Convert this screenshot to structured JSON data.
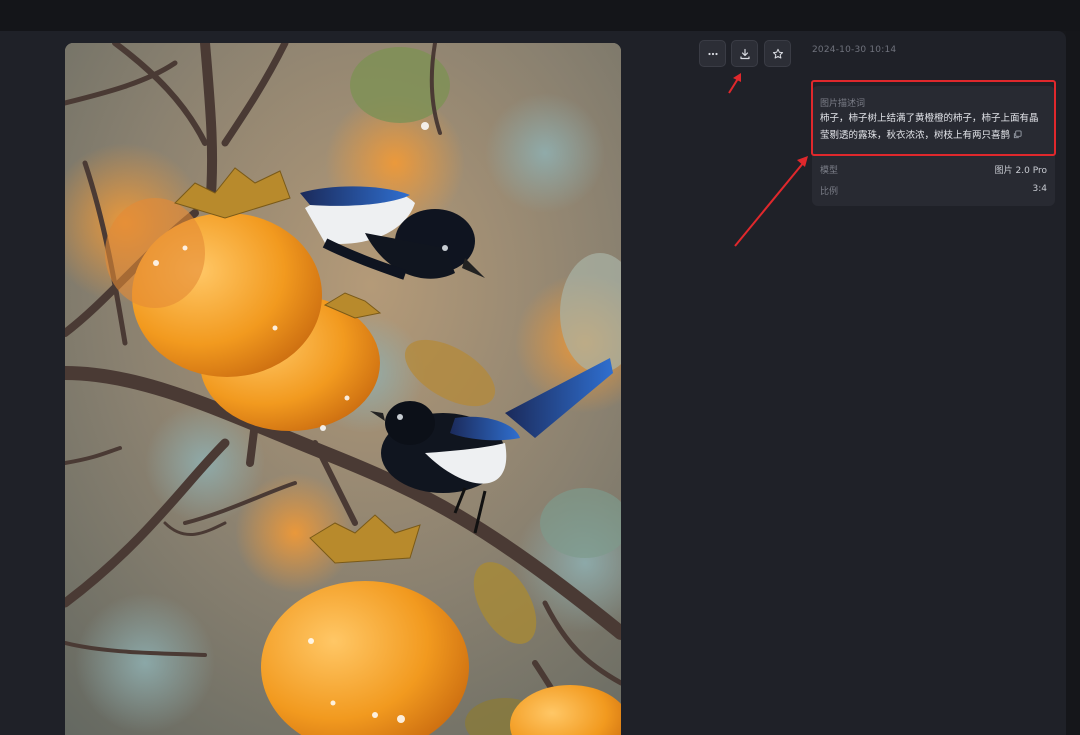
{
  "toolbar": {
    "more_icon": "more-horizontal-icon",
    "download_icon": "download-icon",
    "favorite_icon": "star-icon"
  },
  "info": {
    "timestamp": "2024-10-30 10:14",
    "prompt_label": "图片描述词",
    "prompt_text": "柿子，柿子树上结满了黄橙橙的柿子，柿子上面有晶莹剔透的露珠，秋衣浓浓，树枝上有两只喜鹊",
    "copy_icon": "copy-icon",
    "model_label": "模型",
    "model_value": "图片 2.0 Pro",
    "ratio_label": "比例",
    "ratio_value": "3:4"
  },
  "colors": {
    "background": "#1f2128",
    "card": "#282a32",
    "annotation_red": "#e0282c"
  }
}
